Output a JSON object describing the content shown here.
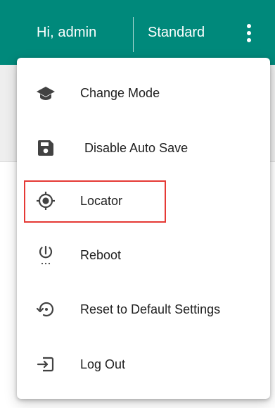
{
  "header": {
    "greeting": "Hi, admin",
    "mode": "Standard",
    "menu_button_icon": "more-vertical-icon",
    "background_color": "#00897b"
  },
  "menu": {
    "items": [
      {
        "label": "Change Mode",
        "icon": "school-cap-icon"
      },
      {
        "label": "Disable Auto Save",
        "icon": "floppy-disk-icon"
      },
      {
        "label": "Locator",
        "icon": "crosshair-locate-icon",
        "highlighted": true
      },
      {
        "label": "Reboot",
        "icon": "power-icon"
      },
      {
        "label": "Reset to Default Settings",
        "icon": "restore-icon"
      },
      {
        "label": "Log Out",
        "icon": "logout-icon"
      }
    ],
    "highlight_color": "#e53935"
  }
}
